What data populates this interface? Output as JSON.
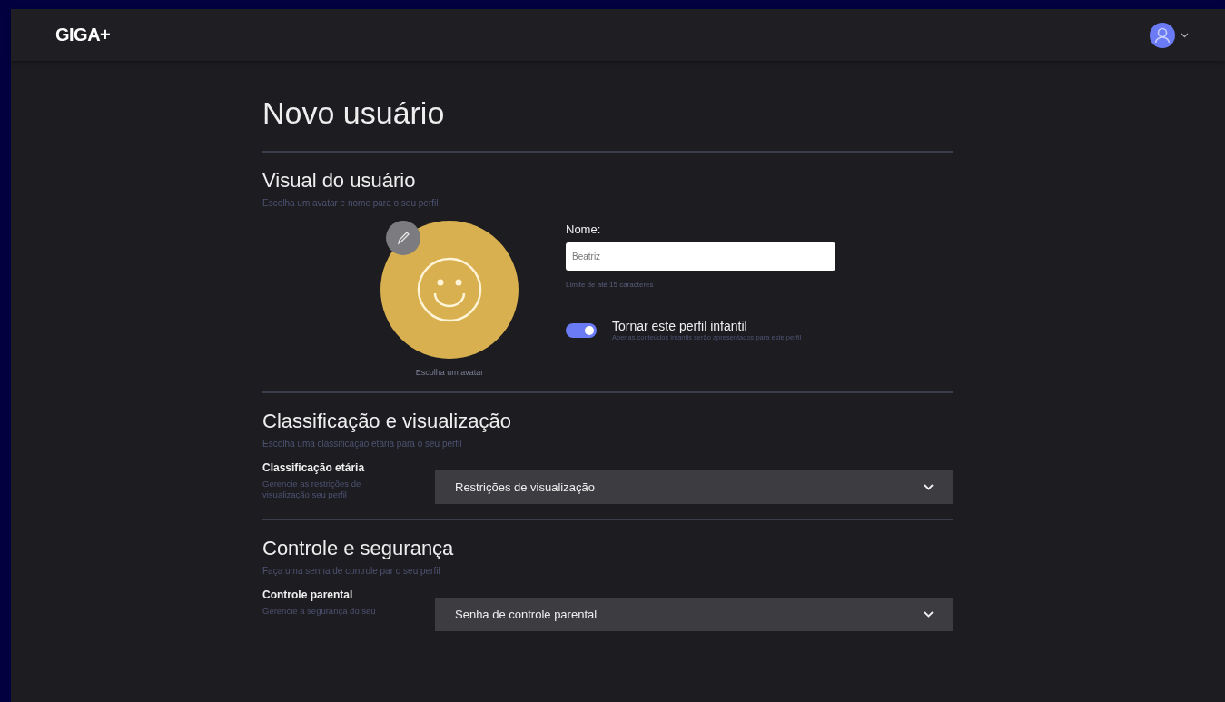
{
  "header": {
    "logo": "GIGA+",
    "account_menu": {
      "expanded": false
    }
  },
  "page": {
    "title": "Novo usuário"
  },
  "sections": [
    {
      "kind": "profile",
      "title": "Visual do usuário",
      "subtitle": "Escolha um avatar e nome para o seu perfil",
      "avatar": {
        "color": "#d8b04f",
        "caption": "Escolha um avatar"
      },
      "name_label": "Nome:",
      "name_value": "Beatriz",
      "name_hint": "Limite de até 15 caracteres",
      "toggle": {
        "label": "Tornar este perfil infantil",
        "hint": "Apenas conteúdos infantis serão apresentados para este perfil",
        "on": true
      }
    },
    {
      "kind": "select",
      "title": "Classificação e visualização",
      "subtitle": "Escolha uma classificação etária para o seu perfil",
      "field_label": "Classificação etária",
      "field_hint": "Gerencie as restrições de visualização seu perfil",
      "select_value": "Restrições de visualização"
    },
    {
      "kind": "select",
      "title": "Controle e segurança",
      "subtitle": "Faça uma senha de controle par o seu perfil",
      "field_label": "Controle parental",
      "field_hint": "Gerencie a segurança do seu",
      "select_value": "Senha de controle parental"
    }
  ]
}
